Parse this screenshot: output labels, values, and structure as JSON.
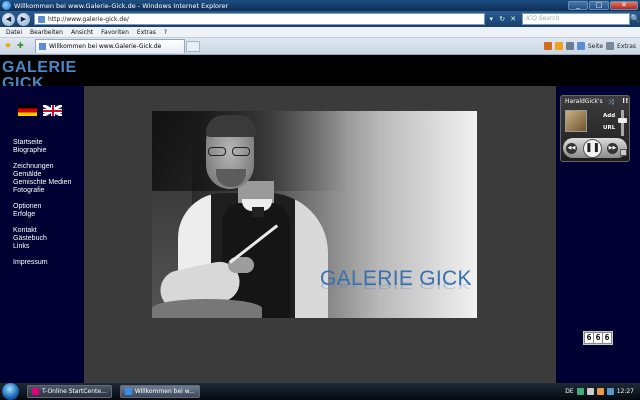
{
  "window": {
    "title": "Willkommen bei www.Galerie-Gick.de - Windows Internet Explorer",
    "min": "_",
    "max": "□",
    "close": "✕"
  },
  "addressbar": {
    "url": "http://www.galerie-gick.de/",
    "search_placeholder": "ICQ Search",
    "refresh": "↻",
    "stop": "✕",
    "dropdown": "▾",
    "search_go": "🔍"
  },
  "menu": [
    "Datei",
    "Bearbeiten",
    "Ansicht",
    "Favoriten",
    "Extras",
    "?"
  ],
  "tab": {
    "label": "Willkommen bei www.Galerie-Gick.de"
  },
  "commandbar": {
    "seite": "Seite",
    "extras": "Extras"
  },
  "site": {
    "logo": "GALERIE GICK",
    "hero_caption": "GALERIE GICK",
    "nav_groups": [
      [
        "Startseite",
        "Biographie"
      ],
      [
        "Zeichnungen",
        "Gemälde",
        "Gemischte Medien",
        "Fotografie"
      ],
      [
        "Optionen",
        "Erfolge"
      ],
      [
        "Kontakt",
        "Gästebuch",
        "Links"
      ],
      [
        "Impressum"
      ]
    ],
    "counter": [
      "6",
      "6",
      "6"
    ]
  },
  "player": {
    "title": "HaraldGick's",
    "add": "Add",
    "url": "URL"
  },
  "taskbar": {
    "buttons": [
      "T-Online StartCente...",
      "Willkommen bei w..."
    ],
    "lang": "DE",
    "time": "12:27"
  },
  "colors": {
    "sidebar_bg": "#000033",
    "content_bg": "#3b3b3b",
    "logo": "#4a86c8"
  }
}
